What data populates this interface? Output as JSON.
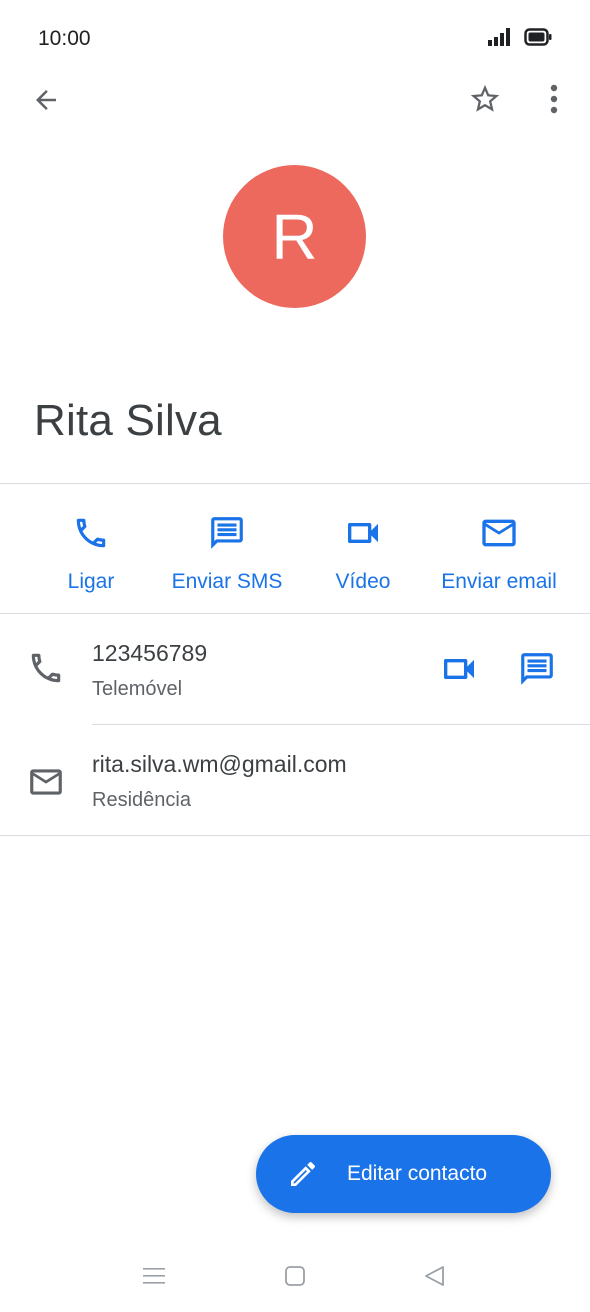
{
  "status_bar": {
    "time": "10:00",
    "icons": [
      "signal-icon",
      "battery-icon"
    ]
  },
  "app_bar": {
    "icons": [
      "back-arrow-icon",
      "star-outline-icon",
      "more-vert-icon"
    ]
  },
  "contact": {
    "avatar_letter": "R",
    "avatar_color": "#ed695e",
    "name": "Rita Silva"
  },
  "actions": [
    {
      "label": "Ligar",
      "icon": "phone-icon"
    },
    {
      "label": "Enviar SMS",
      "icon": "message-icon"
    },
    {
      "label": "Vídeo",
      "icon": "videocam-icon"
    },
    {
      "label": "Enviar email",
      "icon": "email-icon"
    }
  ],
  "details": {
    "phone": {
      "value": "123456789",
      "type": "Telemóvel"
    },
    "email": {
      "value": "rita.silva.wm@gmail.com",
      "type": "Residência"
    }
  },
  "fab": {
    "label": "Editar contacto",
    "icon": "pencil-icon"
  },
  "nav_bar": {
    "icons": [
      "recents-icon",
      "home-icon",
      "back-triangle-icon"
    ]
  },
  "colors": {
    "accent": "#1a73e8",
    "icon_gray": "#5f6368",
    "divider": "#dadce0"
  }
}
